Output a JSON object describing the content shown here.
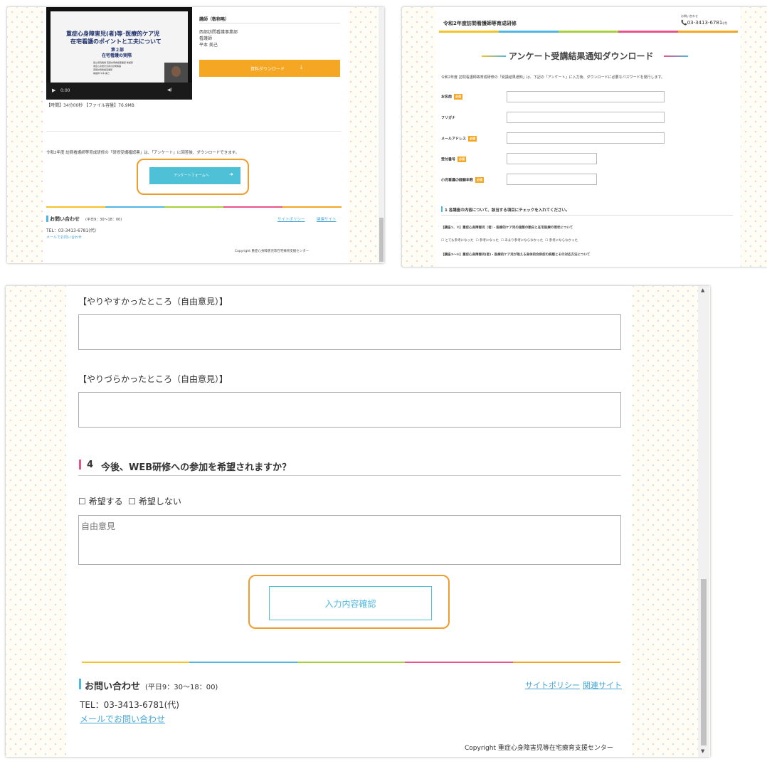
{
  "panel1": {
    "video": {
      "title_line1": "重症心身障害児(者)等･医療的ケア児",
      "title_line2": "在宅看護のポイントと工夫について",
      "part": "第２部",
      "subtitle": "在宅看護の実際",
      "time": "0:00",
      "small_lines": [
        "国立病院機構 西部訪問看護事業部 看護部",
        "重症心身障害児者の訪問看護",
        "西部訪問看護事業部",
        "看護師 平本 美己"
      ]
    },
    "instructor": {
      "heading": "講師（敬称略）",
      "lines": [
        "西部訪問看護事業部",
        "看護師",
        "平本 美己"
      ]
    },
    "download_label": "資料ダウンロード",
    "file_info": "【時間】34分00秒 【ファイル容量】76.9MB",
    "notice": "令和2年度 訪問看護師等育成研修の「研修受講確認票」は、「アンケート」に回答後、ダウンロードできます。",
    "survey_button": "アンケートフォームへ",
    "contact_title": "お問い合わせ",
    "contact_hours": "(平日9：30～18：00)",
    "tel": "TEL：03-3413-6781(代)",
    "mail_link": "メールでお問い合わせ",
    "policy_link": "サイトポリシー",
    "related_link": "関連サイト",
    "copyright": "Copyright 重症心身障害児等在宅療育支援センター"
  },
  "panel2": {
    "site_title": "令和2年度訪問看護師等育成研修",
    "contact_small": "お問い合わせ",
    "phone": "03-3413-6781",
    "phone_suffix": "(代)",
    "page_heading": "アンケート受講結果通知ダウンロード",
    "intro": "令和2年度 訪問看護師等育成研修の「受講結果通知」は、下記の「アンケート」に入力後、ダウンロードに必要なパスワードを発行します。",
    "required": "必須",
    "fields": [
      "お名前",
      "フリガナ",
      "メールアドレス",
      "受付番号",
      "小児看護の経験年数"
    ],
    "section1": "1 各講座の内容について、該当する項目にチェックを入れてください。",
    "q1": "【講座①、②】重症心身障害児（者）・医療的ケア児の施策の動向と在宅医療の現状について",
    "options": [
      "とても参考になった",
      "参考になった",
      "あまり参考にならなかった",
      "参考にならなかった"
    ],
    "q2": "【講座③～⑤】重症心身障害児(者)・医療的ケア児が抱える身体的合併症の病態とその対応方法について"
  },
  "panel3": {
    "easy_label": "【やりやすかったところ（自由意見）】",
    "hard_label": "【やりづらかったところ（自由意見）】",
    "q4_number": "4",
    "q4_text": "今後、WEB研修への参加を希望されますか？",
    "opt_yes": "希望する",
    "opt_no": "希望しない",
    "free_placeholder": "自由意見",
    "confirm_button": "入力内容確認",
    "contact_title": "お問い合わせ",
    "contact_hours": "(平日9：30～18：00)",
    "tel": "TEL：03-3413-6781(代)",
    "mail_link": "メールでお問い合わせ",
    "policy_link": "サイトポリシー",
    "related_link": "関連サイト",
    "copyright": "Copyright 重症心身障害児等在宅療育支援センター"
  },
  "colors": {
    "accent_orange": "#f5a623",
    "highlight_ring": "#ef9d2c",
    "teal_button": "#4fc1d6",
    "link_blue": "#4aa8d8",
    "rainbow": [
      "#f6c22a",
      "#4fb7e1",
      "#a8cf3c",
      "#e8558a",
      "#f5a623"
    ]
  }
}
